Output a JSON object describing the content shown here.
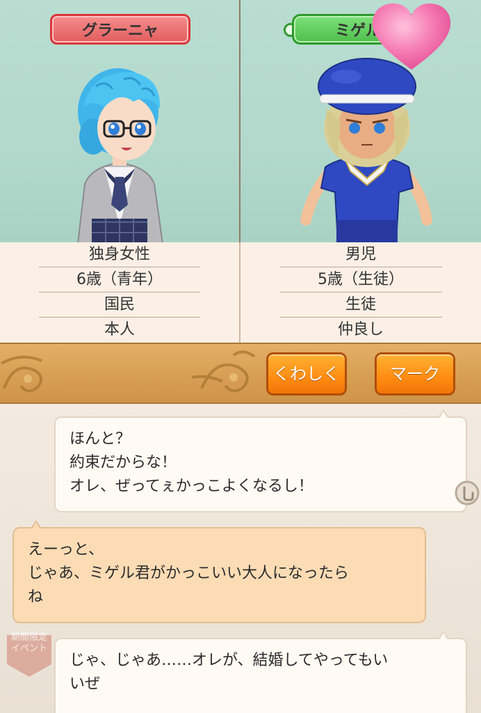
{
  "left_character": {
    "name": "グラーニャ",
    "info": [
      "独身女性",
      "6歳（青年）",
      "国民",
      "本人"
    ]
  },
  "right_character": {
    "name": "ミゲル",
    "info": [
      "男児",
      "5歳（生徒）",
      "生徒",
      "仲良し"
    ]
  },
  "buttons": {
    "details": "くわしく",
    "mark": "マーク"
  },
  "chat": [
    {
      "speaker": "right",
      "lines": [
        "ほんと？",
        "約束だからな！",
        "オレ、ぜってぇかっこよくなるし！"
      ]
    },
    {
      "speaker": "left",
      "lines": [
        "えーっと、",
        "じゃあ、ミゲル君がかっこいい大人になったら",
        "ね"
      ]
    },
    {
      "speaker": "right",
      "lines": [
        "じゃ、じゃあ……オレが、結婚してやってもい",
        "いぜ"
      ]
    }
  ],
  "event_badge": [
    "期間限定",
    "イベント"
  ],
  "colors": {
    "female_tag": "#e25c5c",
    "male_tag": "#4ebe4a",
    "button": "#ff8c12",
    "portrait_bg": "#b2d9cc"
  }
}
